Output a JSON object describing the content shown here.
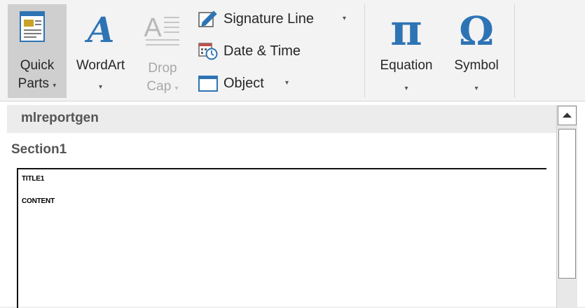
{
  "ribbon": {
    "quick_parts": {
      "line1": "Quick",
      "line2": "Parts",
      "arrow": "▾",
      "icon": "quick-parts-icon"
    },
    "wordart": {
      "label": "WordArt",
      "arrow": "▾",
      "icon": "wordart-icon",
      "glyph": "A"
    },
    "drop_cap": {
      "line1": "Drop",
      "line2": "Cap",
      "arrow": "▾",
      "icon": "drop-cap-icon",
      "glyph": "A"
    },
    "signature_line": {
      "label": "Signature Line",
      "arrow": "▾",
      "icon": "signature-line-icon"
    },
    "date_time": {
      "label": "Date & Time",
      "icon": "date-time-icon"
    },
    "object": {
      "label": "Object",
      "arrow": "▾",
      "icon": "object-icon"
    },
    "equation": {
      "label": "Equation",
      "arrow": "▾",
      "icon": "pi-icon",
      "glyph": "π"
    },
    "symbol": {
      "label": "Symbol",
      "arrow": "▾",
      "icon": "omega-icon",
      "glyph": "Ω"
    }
  },
  "gallery": {
    "header": "mlreportgen",
    "section": "Section1",
    "preview_lines": [
      "TITLE1",
      "CONTENT"
    ]
  },
  "colors": {
    "accent": "#2e74b5",
    "pressed": "#cfcfcf"
  }
}
